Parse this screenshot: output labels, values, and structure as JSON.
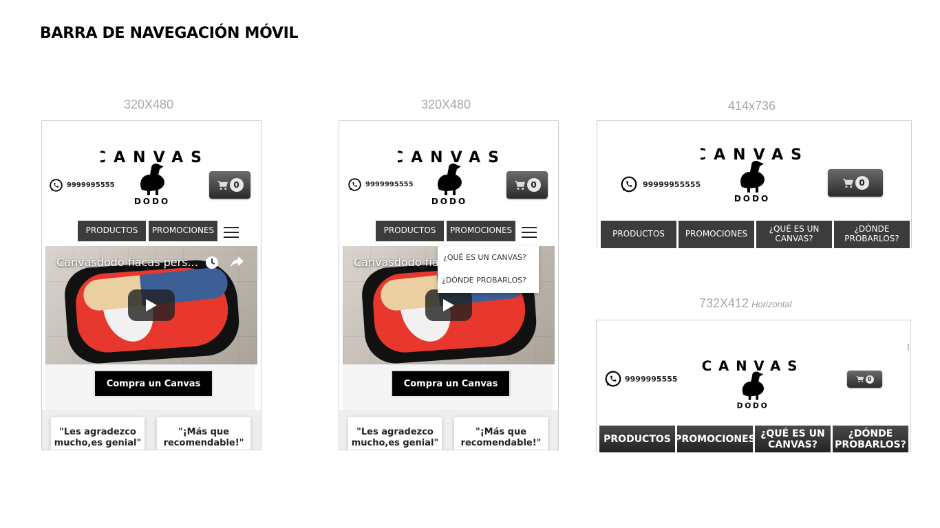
{
  "page_title": "BARRA DE NAVEGACIÓN MÓVIL",
  "mockups": [
    {
      "size_label": "320X480",
      "phone": "9999995555",
      "cart_count": "0",
      "nav": [
        "PRODUCTOS",
        "PROMOCIONES"
      ],
      "video_title": "Canvasdodo fiacas pers...",
      "cta": "Compra un Canvas",
      "testimonials": [
        "\"Les agradezco mucho,es genial\"",
        "\"¡Más que recomendable!\""
      ]
    },
    {
      "size_label": "320X480",
      "phone": "9999995555",
      "cart_count": "0",
      "nav": [
        "PRODUCTOS",
        "PROMOCIONES"
      ],
      "video_title": "Canvasdodo fia",
      "dropdown": [
        "¿QUÉ ES UN CANVAS?",
        "¿DÓNDE PROBARLOS?"
      ],
      "cta": "Compra un Canvas",
      "testimonials": [
        "\"Les agradezco mucho,es genial\"",
        "\"¡Más que recomendable!\""
      ]
    },
    {
      "size_label": "414x736",
      "phone": "99999955555",
      "cart_count": "0",
      "nav": [
        "PRODUCTOS",
        "PROMOCIONES",
        "¿QUÉ ES UN CANVAS?",
        "¿DÓNDE PROBARLOS?"
      ]
    },
    {
      "size_label": "732X412",
      "orientation": "Horizontal",
      "phone": "9999995555",
      "cart_count": "0",
      "nav": [
        "PRODUCTOS",
        "PROMOCIONES",
        "¿QUÉ ES UN CANVAS?",
        "¿DÓNDE PROBARLOS?"
      ]
    }
  ],
  "logo": {
    "top_word": "CANVAS",
    "bottom_word": "DODO"
  },
  "icons": [
    "whatsapp-icon",
    "cart-icon",
    "hamburger-menu-icon",
    "clock-icon",
    "share-icon",
    "play-icon"
  ],
  "colors": {
    "nav_button": "#3c3c3c",
    "cta": "#000000",
    "dimension_label": "#a8a8a8"
  }
}
